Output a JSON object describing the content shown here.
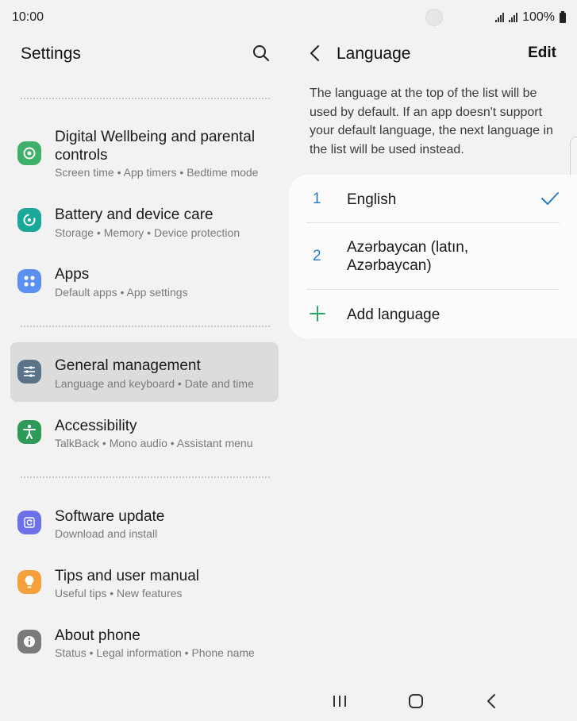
{
  "status": {
    "time": "10:00",
    "battery": "100%"
  },
  "left": {
    "title": "Settings",
    "items": [
      {
        "title": "Digital Wellbeing and parental controls",
        "sub": "Screen time  •  App timers  •  Bedtime mode",
        "icon": "digital-wellbeing-icon",
        "color": "#3fb06a"
      },
      {
        "title": "Battery and device care",
        "sub": "Storage  •  Memory  •  Device protection",
        "icon": "device-care-icon",
        "color": "#1aa89a"
      },
      {
        "title": "Apps",
        "sub": "Default apps  •  App settings",
        "icon": "apps-icon",
        "color": "#5b8ff0"
      },
      {
        "title": "General management",
        "sub": "Language and keyboard  •  Date and time",
        "icon": "sliders-icon",
        "color": "#5b7388"
      },
      {
        "title": "Accessibility",
        "sub": "TalkBack  •  Mono audio  •  Assistant menu",
        "icon": "accessibility-icon",
        "color": "#2e9a58"
      },
      {
        "title": "Software update",
        "sub": "Download and install",
        "icon": "software-update-icon",
        "color": "#6b72e8"
      },
      {
        "title": "Tips and user manual",
        "sub": "Useful tips  •  New features",
        "icon": "lightbulb-icon",
        "color": "#f5a03a"
      },
      {
        "title": "About phone",
        "sub": "Status  •  Legal information  •  Phone name",
        "icon": "info-icon",
        "color": "#7a7a7a"
      }
    ]
  },
  "right": {
    "title": "Language",
    "edit_label": "Edit",
    "description": "The language at the top of the list will be used by default. If an app doesn't support your default language, the next language in the list will be used instead.",
    "languages": [
      {
        "num": "1",
        "name": "English",
        "selected": true
      },
      {
        "num": "2",
        "name": "Azərbaycan (latın, Azərbaycan)",
        "selected": false
      }
    ],
    "add_label": "Add language"
  },
  "colors": {
    "accent": "#2a7dc6",
    "add_green": "#2aa86a",
    "selected_bg": "#dcdcdc",
    "background": "#f2f2f2"
  }
}
